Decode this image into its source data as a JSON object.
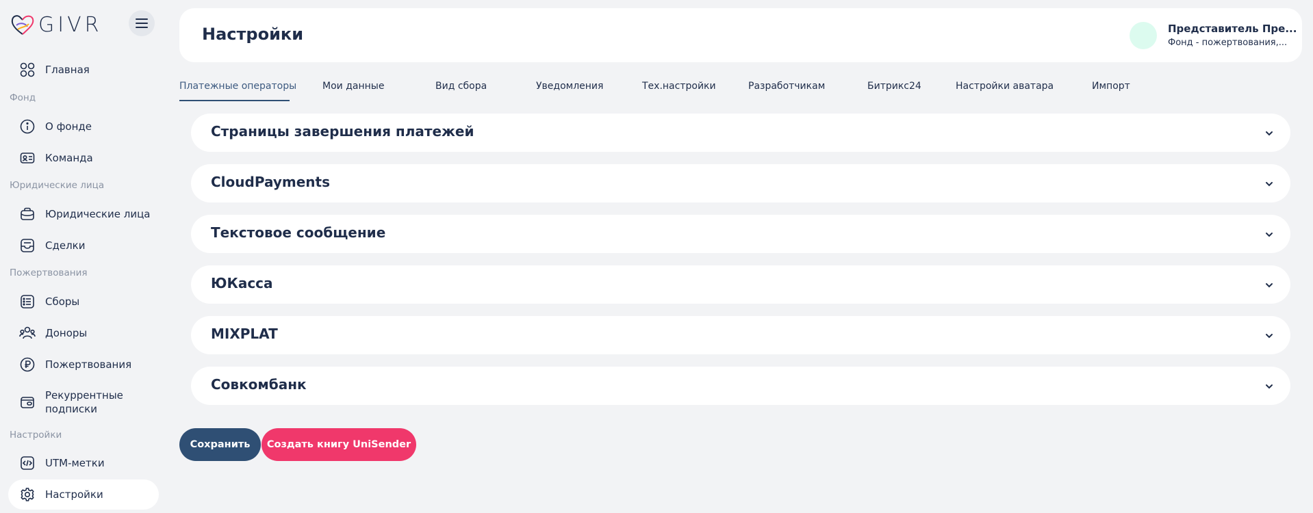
{
  "app": {
    "logo_text": "GIVR"
  },
  "sidebar": {
    "items": [
      {
        "label": "Главная",
        "icon": "grid-icon"
      },
      {
        "label": "О фонде",
        "icon": "info-icon"
      },
      {
        "label": "Команда",
        "icon": "id-card-icon"
      },
      {
        "label": "Юридические лица",
        "icon": "briefcase-icon"
      },
      {
        "label": "Сделки",
        "icon": "inbox-icon"
      },
      {
        "label": "Сборы",
        "icon": "list-icon"
      },
      {
        "label": "Доноры",
        "icon": "users-icon"
      },
      {
        "label": "Пожертвования",
        "icon": "ruble-icon"
      },
      {
        "label": "Рекуррентные подписки",
        "icon": "wallet-icon"
      },
      {
        "label": "UTM-метки",
        "icon": "code-icon"
      },
      {
        "label": "Настройки",
        "icon": "gear-icon",
        "active": true
      }
    ],
    "sections": {
      "fund": "Фонд",
      "legal": "Юридические лица",
      "donations": "Пожертвования",
      "settings": "Настройки"
    }
  },
  "header": {
    "title": "Настройки",
    "user_name": "Представитель Пре...",
    "user_org": "Фонд - пожертвования,..."
  },
  "tabs": [
    {
      "label": "Платежные операторы",
      "active": true
    },
    {
      "label": "Мои данные"
    },
    {
      "label": "Вид сбора"
    },
    {
      "label": "Уведомления"
    },
    {
      "label": "Тех.настройки"
    },
    {
      "label": "Разработчикам"
    },
    {
      "label": "Битрикс24"
    },
    {
      "label": "Настройки аватара"
    },
    {
      "label": "Импорт"
    }
  ],
  "panels": [
    {
      "title": "Страницы завершения платежей"
    },
    {
      "title": "CloudPayments"
    },
    {
      "title": "Текстовое сообщение"
    },
    {
      "title": "ЮКасса"
    },
    {
      "title": "MIXPLAT"
    },
    {
      "title": "Совкомбанк"
    }
  ],
  "actions": {
    "save_label": "Сохранить",
    "unisender_label": "Создать книгу UniSender"
  },
  "colors": {
    "primary": "#2f4f74",
    "accent": "#f0386b",
    "text": "#1f2d4a",
    "background": "#f2f3f5"
  }
}
